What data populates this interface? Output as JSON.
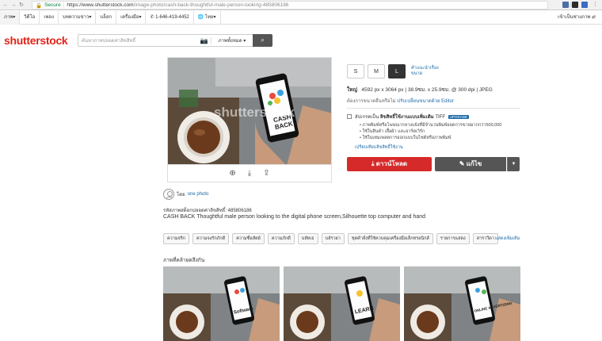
{
  "browser": {
    "secure_label": "Secure",
    "url_host": "https://www.shutterstock.com",
    "url_path": "/image-photo/cash-back-thoughtful-male-person-looking-485806186"
  },
  "topnav": {
    "items": [
      "ภาพ▾",
      "วิดีโอ",
      "เพลง",
      "บทความข่าว▾",
      "บล็อก",
      "เครื่องมือ▾"
    ],
    "phone": "1-646-419-4452",
    "language": "ไทย▾",
    "account": "เข้าเป็นช่างภาพ ⇄"
  },
  "header": {
    "logo": "shutterstock",
    "search_placeholder": "ค้นหาภาพปลอดค่าลิขสิทธิ์",
    "search_type": "ภาพทั้งหมด ▾"
  },
  "image": {
    "watermark": "shutterstock",
    "phone_text_1": "CASH",
    "phone_text_2": "BACK"
  },
  "sizes": {
    "options": [
      "S",
      "M",
      "L"
    ],
    "selected": "L",
    "help_label": "คำแนะนำเรื่องขนาด"
  },
  "meta": {
    "size_label": "ใหญ่",
    "pixels": "4592 px x 3064 px",
    "cm": "38.9ซม. x 25.9ซม. @ 300 dpi",
    "format": "JPEG",
    "resize_text": "ต้องการขนาดอื่นหรือไม่",
    "resize_link": "ปรับเปลี่ยนขนาดด้วย Editor"
  },
  "license": {
    "label_prefix": "อัปเกรดเป็น",
    "label_bold": "ลิขสิทธิ์ใช้งานแบบเพิ่มเติม",
    "label_suffix": "TIFF",
    "upgrade_badge": "UPGRADE",
    "bullets": [
      "• ภาพพิมพ์หรือโฆษณากลางแจ้งที่มีจำนวนพิมพ์ยอดการขายมากกว่า500,000",
      "• ใช้ในสินค้า เสื้อผ้า และอาร์ตเวิร์ก",
      "• ใช้ในเทมเพลตการออกแบบในไซต์หรือภาพพิมพ์"
    ],
    "compare_link": "เปรียบเทียบลิขสิทธิ์ใช้งาน"
  },
  "actions": {
    "download": "ดาวน์โหลด",
    "edit": "แก้ไข"
  },
  "contributor": {
    "by": "โดย",
    "name": "one photo"
  },
  "stock_id": "รหัสภาพสต็อกปลอดค่าลิขสิทธิ์: 485806186",
  "title": "CASH BACK Thoughtful male person looking to the digital phone screen,Silhouette top computer and hand",
  "tags": [
    "ความจริก",
    "ความจงรักภักดี",
    "ความซื่อสัตย์",
    "ความภักดี",
    "บลัทเธ",
    "บลัรวยา",
    "ชุดคำสั่งที่ใช้ควบคุมเครื่องมือเล็กทรอนิกส์",
    "รายการแสดง",
    "สาราวีดา"
  ],
  "more_tags": "แสดงเพิ่มเติม",
  "similar": {
    "heading": "ภาพที่คล้ายคลึงกัน",
    "thumbs": [
      {
        "phone_text": "Software"
      },
      {
        "phone_text": "LEARN"
      },
      {
        "phone_text": "ONLINE ADVERTISING"
      }
    ]
  },
  "colors": {
    "brand_red": "#e32318",
    "download_red": "#d6292a",
    "link_blue": "#1a6aa8"
  }
}
